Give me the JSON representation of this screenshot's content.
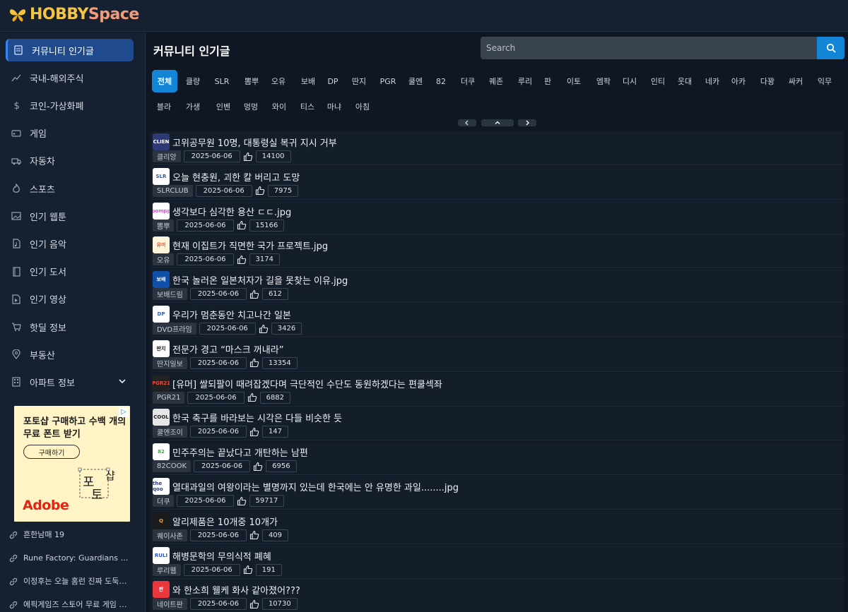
{
  "brand": {
    "part1": "HOBBY",
    "part2": "Space"
  },
  "sidebar": {
    "items": [
      {
        "label": "커뮤니티 인기글",
        "icon": "document-icon",
        "active": true
      },
      {
        "label": "국내-해외주식",
        "icon": "chart-line-icon"
      },
      {
        "label": "코인-가상화폐",
        "icon": "dollar-icon"
      },
      {
        "label": "게임",
        "icon": "gamepad-icon"
      },
      {
        "label": "자동차",
        "icon": "truck-icon"
      },
      {
        "label": "스포츠",
        "icon": "flame-icon"
      },
      {
        "label": "인기 웹툰",
        "icon": "image-icon"
      },
      {
        "label": "인기 음악",
        "icon": "music-file-icon"
      },
      {
        "label": "인기 도서",
        "icon": "book-icon"
      },
      {
        "label": "인기 영상",
        "icon": "video-file-icon"
      },
      {
        "label": "핫딜 정보",
        "icon": "cart-icon"
      },
      {
        "label": "부동산",
        "icon": "map-pin-icon"
      },
      {
        "label": "아파트 정보",
        "icon": "building-icon"
      }
    ],
    "ad": {
      "title": "포토샵 구매하고 수백 개의 무료 폰트 받기",
      "button": "구매하기",
      "brand": "Adobe"
    },
    "links": [
      {
        "label": "흔한남매 19"
      },
      {
        "label": "Rune Factory: Guardians of ..."
      },
      {
        "label": "이정후는 오늘 홈런 진짜 도둑맞..."
      },
      {
        "label": "에픽게임즈 스토어 무료 게임 배포"
      }
    ]
  },
  "main": {
    "title": "커뮤니티 인기글",
    "search": {
      "placeholder": "Search"
    },
    "tabs_row1": [
      "전체",
      "클량",
      "SLR",
      "뽐뿌",
      "오유",
      "보배",
      "DP",
      "딴지",
      "PGR",
      "쿨엔",
      "82",
      "더쿠",
      "퀘존",
      "루리",
      "판",
      "이토",
      "엠팍",
      "디시",
      "인티",
      "웃대",
      "네카",
      "아카",
      "다꽝",
      "싸커",
      "익무"
    ],
    "tabs_row2": [
      "블라",
      "가생",
      "인벤",
      "멍멍",
      "와이",
      "티스",
      "마냐",
      "아침"
    ],
    "posts": [
      {
        "title": "고위공무원 10명, 대통령실 복귀 지시 거부",
        "source": "클리앙",
        "date": "2025-06-06",
        "likes": "14100",
        "icon_text": "CLIEN",
        "icon_bg": "#2e3a78",
        "icon_fg": "#ffffff"
      },
      {
        "title": "오늘 현충원, 괴한 칼 버리고 도망",
        "source": "SLRCLUB",
        "date": "2025-06-06",
        "likes": "7975",
        "icon_text": "SLR",
        "icon_bg": "#ffffff",
        "icon_fg": "#1f5fb5"
      },
      {
        "title": "생각보다 심각한 용산 ㄷㄷ.jpg",
        "source": "뽐뿌",
        "date": "2025-06-06",
        "likes": "15166",
        "icon_text": "ppomppu",
        "icon_bg": "#ffffff",
        "icon_fg": "#c85ad6"
      },
      {
        "title": "현재 이집트가 직면한 국가 프로젝트.jpg",
        "source": "오유",
        "date": "2025-06-06",
        "likes": "3174",
        "icon_text": "유머",
        "icon_bg": "#fff4dc",
        "icon_fg": "#e55a2b"
      },
      {
        "title": "한국 놀러온 일본처자가 길을 못찾는 이유.jpg",
        "source": "보배드림",
        "date": "2025-06-06",
        "likes": "612",
        "icon_text": "보배",
        "icon_bg": "#0f4fa8",
        "icon_fg": "#ffffff"
      },
      {
        "title": "우리가 멈춘동안 치고나간 일본",
        "source": "DVD프라임",
        "date": "2025-06-06",
        "likes": "3426",
        "icon_text": "DP",
        "icon_bg": "#ffffff",
        "icon_fg": "#2a62b5"
      },
      {
        "title": "전문가 경고 “마스크 꺼내라”",
        "source": "딴지일보",
        "date": "2025-06-06",
        "likes": "13354",
        "icon_text": "딴지",
        "icon_bg": "#ffffff",
        "icon_fg": "#111111"
      },
      {
        "title": "[유머] 쌀되팔이 때려잡겠다며 극단적인 수단도 동원하겠다는 편쿨섹좌",
        "source": "PGR21",
        "date": "2025-06-06",
        "likes": "6882",
        "icon_text": "PGR21",
        "icon_bg": "#222222",
        "icon_fg": "#e84a3c"
      },
      {
        "title": "한국 축구를 바라보는 시각은 다들 비슷한 듯",
        "source": "쿨엔조이",
        "date": "2025-06-06",
        "likes": "147",
        "icon_text": "COOL",
        "icon_bg": "#e6e6e6",
        "icon_fg": "#222222"
      },
      {
        "title": "민주주의는 끝났다고 개탄하는 남편",
        "source": "82COOK",
        "date": "2025-06-06",
        "likes": "6956",
        "icon_text": "82",
        "icon_bg": "#ffffff",
        "icon_fg": "#3aa845"
      },
      {
        "title": "열대과일의 여왕이라는 별명까지 있는데 한국에는 안 유명한 과일........jpg",
        "source": "더쿠",
        "date": "2025-06-06",
        "likes": "59717",
        "icon_text": "the qoo",
        "icon_bg": "#ffffff",
        "icon_fg": "#2b3a8c"
      },
      {
        "title": "알리제품은 10개중 10개가",
        "source": "퀘이사존",
        "date": "2025-06-06",
        "likes": "409",
        "icon_text": "Q",
        "icon_bg": "#1b1b1b",
        "icon_fg": "#f0a01a"
      },
      {
        "title": "해병문학의 무의식적 폐혜",
        "source": "루리웹",
        "date": "2025-06-06",
        "likes": "191",
        "icon_text": "RULI",
        "icon_bg": "#ffffff",
        "icon_fg": "#2a55c9"
      },
      {
        "title": "와 한소희 웰케 화사 같아졌어???",
        "source": "네이트판",
        "date": "2025-06-06",
        "likes": "10730",
        "icon_text": "판",
        "icon_bg": "#e8383d",
        "icon_fg": "#ffffff"
      }
    ]
  },
  "colors": {
    "accent": "#1385d6",
    "active_nav": "#1f4a8e",
    "background": "#0f1724",
    "panel": "#152030"
  }
}
